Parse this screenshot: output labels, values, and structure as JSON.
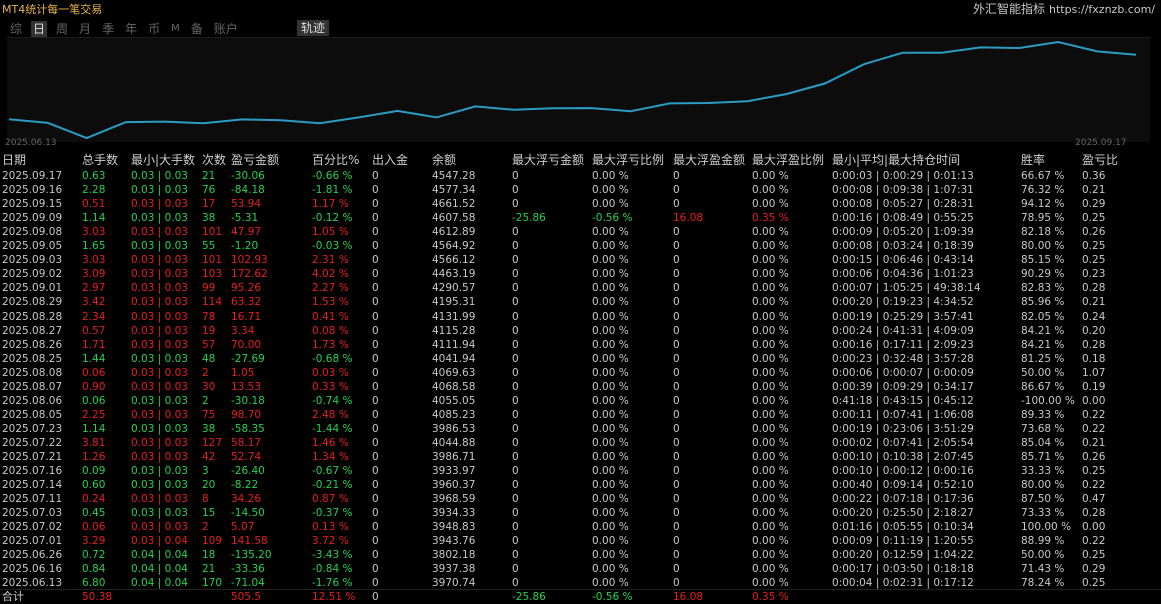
{
  "app": {
    "title": "MT4统计每一笔交易",
    "brand": "外汇智能指标",
    "brand_url": "https://fxznzb.com/"
  },
  "tabs": [
    {
      "label": "综",
      "active": false
    },
    {
      "label": "日",
      "active": true
    },
    {
      "label": "周",
      "active": false
    },
    {
      "label": "月",
      "active": false
    },
    {
      "label": "季",
      "active": false
    },
    {
      "label": "年",
      "active": false
    },
    {
      "label": "币",
      "active": false
    },
    {
      "label": "M",
      "active": false
    },
    {
      "label": "备",
      "active": false
    },
    {
      "label": "账户",
      "active": false
    }
  ],
  "track_button": "轨迹",
  "chart_data": {
    "type": "line",
    "x_start_label": "2025.06.13",
    "x_end_label": "2025.09.17",
    "color": "#2a9dc4",
    "values": [
      3970.74,
      3937.38,
      3802.18,
      3943.76,
      3948.83,
      3934.33,
      3968.59,
      3960.37,
      3933.97,
      3986.71,
      4044.88,
      3986.53,
      4085.23,
      4055.05,
      4068.58,
      4069.63,
      4041.94,
      4111.94,
      4115.28,
      4131.99,
      4195.31,
      4290.57,
      4463.19,
      4566.12,
      4564.92,
      4612.89,
      4607.58,
      4661.52,
      4577.34,
      4547.28
    ]
  },
  "colors": {
    "positive": "#26d04f",
    "negative": "#e61e1e",
    "neutral": "#c8c8c8"
  },
  "table": {
    "columns": [
      "日期",
      "总手数",
      "最小|大手数",
      "次数",
      "盈亏金额",
      "百分比%",
      "出入金",
      "余额",
      "最大浮亏金额",
      "最大浮亏比例",
      "最大浮盈金额",
      "最大浮盈比例",
      "最小|平均|最大持仓时间",
      "胜率",
      "盈亏比"
    ],
    "rows": [
      {
        "date": "2025.09.17",
        "lots": "0.63",
        "minmax": "0.03 | 0.03",
        "count": "21",
        "pl": "-30.06",
        "pct": "-0.66 %",
        "dep": "0",
        "bal": "4547.28",
        "mfl": "0",
        "mflp": "0.00 %",
        "mfp": "0",
        "mfpp": "0.00 %",
        "hold": "0:00:03 | 0:00:29 | 0:01:13",
        "win": "66.67 %",
        "rr": "0.36",
        "sign": "pos"
      },
      {
        "date": "2025.09.16",
        "lots": "2.28",
        "minmax": "0.03 | 0.03",
        "count": "76",
        "pl": "-84.18",
        "pct": "-1.81 %",
        "dep": "0",
        "bal": "4577.34",
        "mfl": "0",
        "mflp": "0.00 %",
        "mfp": "0",
        "mfpp": "0.00 %",
        "hold": "0:00:08 | 0:09:38 | 1:07:31",
        "win": "76.32 %",
        "rr": "0.21",
        "sign": "pos"
      },
      {
        "date": "2025.09.15",
        "lots": "0.51",
        "minmax": "0.03 | 0.03",
        "count": "17",
        "pl": "53.94",
        "pct": "1.17 %",
        "dep": "0",
        "bal": "4661.52",
        "mfl": "0",
        "mflp": "0.00 %",
        "mfp": "0",
        "mfpp": "0.00 %",
        "hold": "0:00:08 | 0:05:27 | 0:28:31",
        "win": "94.12 %",
        "rr": "0.29",
        "sign": "neg"
      },
      {
        "date": "2025.09.09",
        "lots": "1.14",
        "minmax": "0.03 | 0.03",
        "count": "38",
        "pl": "-5.31",
        "pct": "-0.12 %",
        "dep": "0",
        "bal": "4607.58",
        "mfl": "-25.86",
        "mflp": "-0.56 %",
        "mfp": "16.08",
        "mfpp": "0.35 %",
        "hold": "0:00:16 | 0:08:49 | 0:55:25",
        "win": "78.95 %",
        "rr": "0.25",
        "sign": "pos"
      },
      {
        "date": "2025.09.08",
        "lots": "3.03",
        "minmax": "0.03 | 0.03",
        "count": "101",
        "pl": "47.97",
        "pct": "1.05 %",
        "dep": "0",
        "bal": "4612.89",
        "mfl": "0",
        "mflp": "0.00 %",
        "mfp": "0",
        "mfpp": "0.00 %",
        "hold": "0:00:09 | 0:05:20 | 1:09:39",
        "win": "82.18 %",
        "rr": "0.26",
        "sign": "neg"
      },
      {
        "date": "2025.09.05",
        "lots": "1.65",
        "minmax": "0.03 | 0.03",
        "count": "55",
        "pl": "-1.20",
        "pct": "-0.03 %",
        "dep": "0",
        "bal": "4564.92",
        "mfl": "0",
        "mflp": "0.00 %",
        "mfp": "0",
        "mfpp": "0.00 %",
        "hold": "0:00:08 | 0:03:24 | 0:18:39",
        "win": "80.00 %",
        "rr": "0.25",
        "sign": "pos"
      },
      {
        "date": "2025.09.03",
        "lots": "3.03",
        "minmax": "0.03 | 0.03",
        "count": "101",
        "pl": "102.93",
        "pct": "2.31 %",
        "dep": "0",
        "bal": "4566.12",
        "mfl": "0",
        "mflp": "0.00 %",
        "mfp": "0",
        "mfpp": "0.00 %",
        "hold": "0:00:15 | 0:06:46 | 0:43:14",
        "win": "85.15 %",
        "rr": "0.25",
        "sign": "neg"
      },
      {
        "date": "2025.09.02",
        "lots": "3.09",
        "minmax": "0.03 | 0.03",
        "count": "103",
        "pl": "172.62",
        "pct": "4.02 %",
        "dep": "0",
        "bal": "4463.19",
        "mfl": "0",
        "mflp": "0.00 %",
        "mfp": "0",
        "mfpp": "0.00 %",
        "hold": "0:00:06 | 0:04:36 | 1:01:23",
        "win": "90.29 %",
        "rr": "0.23",
        "sign": "neg"
      },
      {
        "date": "2025.09.01",
        "lots": "2.97",
        "minmax": "0.03 | 0.03",
        "count": "99",
        "pl": "95.26",
        "pct": "2.27 %",
        "dep": "0",
        "bal": "4290.57",
        "mfl": "0",
        "mflp": "0.00 %",
        "mfp": "0",
        "mfpp": "0.00 %",
        "hold": "0:00:07 | 1:05:25 | 49:38:14",
        "win": "82.83 %",
        "rr": "0.28",
        "sign": "neg"
      },
      {
        "date": "2025.08.29",
        "lots": "3.42",
        "minmax": "0.03 | 0.03",
        "count": "114",
        "pl": "63.32",
        "pct": "1.53 %",
        "dep": "0",
        "bal": "4195.31",
        "mfl": "0",
        "mflp": "0.00 %",
        "mfp": "0",
        "mfpp": "0.00 %",
        "hold": "0:00:20 | 0:19:23 | 4:34:52",
        "win": "85.96 %",
        "rr": "0.21",
        "sign": "neg"
      },
      {
        "date": "2025.08.28",
        "lots": "2.34",
        "minmax": "0.03 | 0.03",
        "count": "78",
        "pl": "16.71",
        "pct": "0.41 %",
        "dep": "0",
        "bal": "4131.99",
        "mfl": "0",
        "mflp": "0.00 %",
        "mfp": "0",
        "mfpp": "0.00 %",
        "hold": "0:00:19 | 0:25:29 | 3:57:41",
        "win": "82.05 %",
        "rr": "0.24",
        "sign": "neg"
      },
      {
        "date": "2025.08.27",
        "lots": "0.57",
        "minmax": "0.03 | 0.03",
        "count": "19",
        "pl": "3.34",
        "pct": "0.08 %",
        "dep": "0",
        "bal": "4115.28",
        "mfl": "0",
        "mflp": "0.00 %",
        "mfp": "0",
        "mfpp": "0.00 %",
        "hold": "0:00:24 | 0:41:31 | 4:09:09",
        "win": "84.21 %",
        "rr": "0.20",
        "sign": "neg"
      },
      {
        "date": "2025.08.26",
        "lots": "1.71",
        "minmax": "0.03 | 0.03",
        "count": "57",
        "pl": "70.00",
        "pct": "1.73 %",
        "dep": "0",
        "bal": "4111.94",
        "mfl": "0",
        "mflp": "0.00 %",
        "mfp": "0",
        "mfpp": "0.00 %",
        "hold": "0:00:16 | 0:17:11 | 2:09:23",
        "win": "84.21 %",
        "rr": "0.28",
        "sign": "neg"
      },
      {
        "date": "2025.08.25",
        "lots": "1.44",
        "minmax": "0.03 | 0.03",
        "count": "48",
        "pl": "-27.69",
        "pct": "-0.68 %",
        "dep": "0",
        "bal": "4041.94",
        "mfl": "0",
        "mflp": "0.00 %",
        "mfp": "0",
        "mfpp": "0.00 %",
        "hold": "0:00:23 | 0:32:48 | 3:57:28",
        "win": "81.25 %",
        "rr": "0.18",
        "sign": "pos"
      },
      {
        "date": "2025.08.08",
        "lots": "0.06",
        "minmax": "0.03 | 0.03",
        "count": "2",
        "pl": "1.05",
        "pct": "0.03 %",
        "dep": "0",
        "bal": "4069.63",
        "mfl": "0",
        "mflp": "0.00 %",
        "mfp": "0",
        "mfpp": "0.00 %",
        "hold": "0:00:06 | 0:00:07 | 0:00:09",
        "win": "50.00 %",
        "rr": "1.07",
        "sign": "neg"
      },
      {
        "date": "2025.08.07",
        "lots": "0.90",
        "minmax": "0.03 | 0.03",
        "count": "30",
        "pl": "13.53",
        "pct": "0.33 %",
        "dep": "0",
        "bal": "4068.58",
        "mfl": "0",
        "mflp": "0.00 %",
        "mfp": "0",
        "mfpp": "0.00 %",
        "hold": "0:00:39 | 0:09:29 | 0:34:17",
        "win": "86.67 %",
        "rr": "0.19",
        "sign": "neg"
      },
      {
        "date": "2025.08.06",
        "lots": "0.06",
        "minmax": "0.03 | 0.03",
        "count": "2",
        "pl": "-30.18",
        "pct": "-0.74 %",
        "dep": "0",
        "bal": "4055.05",
        "mfl": "0",
        "mflp": "0.00 %",
        "mfp": "0",
        "mfpp": "0.00 %",
        "hold": "0:41:18 | 0:43:15 | 0:45:12",
        "win": "-100.00 %",
        "rr": "0.00",
        "sign": "pos"
      },
      {
        "date": "2025.08.05",
        "lots": "2.25",
        "minmax": "0.03 | 0.03",
        "count": "75",
        "pl": "98.70",
        "pct": "2.48 %",
        "dep": "0",
        "bal": "4085.23",
        "mfl": "0",
        "mflp": "0.00 %",
        "mfp": "0",
        "mfpp": "0.00 %",
        "hold": "0:00:11 | 0:07:41 | 1:06:08",
        "win": "89.33 %",
        "rr": "0.22",
        "sign": "neg"
      },
      {
        "date": "2025.07.23",
        "lots": "1.14",
        "minmax": "0.03 | 0.03",
        "count": "38",
        "pl": "-58.35",
        "pct": "-1.44 %",
        "dep": "0",
        "bal": "3986.53",
        "mfl": "0",
        "mflp": "0.00 %",
        "mfp": "0",
        "mfpp": "0.00 %",
        "hold": "0:00:19 | 0:23:06 | 3:51:29",
        "win": "73.68 %",
        "rr": "0.22",
        "sign": "pos"
      },
      {
        "date": "2025.07.22",
        "lots": "3.81",
        "minmax": "0.03 | 0.03",
        "count": "127",
        "pl": "58.17",
        "pct": "1.46 %",
        "dep": "0",
        "bal": "4044.88",
        "mfl": "0",
        "mflp": "0.00 %",
        "mfp": "0",
        "mfpp": "0.00 %",
        "hold": "0:00:02 | 0:07:41 | 2:05:54",
        "win": "85.04 %",
        "rr": "0.21",
        "sign": "neg"
      },
      {
        "date": "2025.07.21",
        "lots": "1.26",
        "minmax": "0.03 | 0.03",
        "count": "42",
        "pl": "52.74",
        "pct": "1.34 %",
        "dep": "0",
        "bal": "3986.71",
        "mfl": "0",
        "mflp": "0.00 %",
        "mfp": "0",
        "mfpp": "0.00 %",
        "hold": "0:00:10 | 0:10:38 | 2:07:45",
        "win": "85.71 %",
        "rr": "0.26",
        "sign": "neg"
      },
      {
        "date": "2025.07.16",
        "lots": "0.09",
        "minmax": "0.03 | 0.03",
        "count": "3",
        "pl": "-26.40",
        "pct": "-0.67 %",
        "dep": "0",
        "bal": "3933.97",
        "mfl": "0",
        "mflp": "0.00 %",
        "mfp": "0",
        "mfpp": "0.00 %",
        "hold": "0:00:10 | 0:00:12 | 0:00:16",
        "win": "33.33 %",
        "rr": "0.25",
        "sign": "pos"
      },
      {
        "date": "2025.07.14",
        "lots": "0.60",
        "minmax": "0.03 | 0.03",
        "count": "20",
        "pl": "-8.22",
        "pct": "-0.21 %",
        "dep": "0",
        "bal": "3960.37",
        "mfl": "0",
        "mflp": "0.00 %",
        "mfp": "0",
        "mfpp": "0.00 %",
        "hold": "0:00:40 | 0:09:14 | 0:52:10",
        "win": "80.00 %",
        "rr": "0.22",
        "sign": "pos"
      },
      {
        "date": "2025.07.11",
        "lots": "0.24",
        "minmax": "0.03 | 0.03",
        "count": "8",
        "pl": "34.26",
        "pct": "0.87 %",
        "dep": "0",
        "bal": "3968.59",
        "mfl": "0",
        "mflp": "0.00 %",
        "mfp": "0",
        "mfpp": "0.00 %",
        "hold": "0:00:22 | 0:07:18 | 0:17:36",
        "win": "87.50 %",
        "rr": "0.47",
        "sign": "neg"
      },
      {
        "date": "2025.07.03",
        "lots": "0.45",
        "minmax": "0.03 | 0.03",
        "count": "15",
        "pl": "-14.50",
        "pct": "-0.37 %",
        "dep": "0",
        "bal": "3934.33",
        "mfl": "0",
        "mflp": "0.00 %",
        "mfp": "0",
        "mfpp": "0.00 %",
        "hold": "0:00:20 | 0:25:50 | 2:18:27",
        "win": "73.33 %",
        "rr": "0.28",
        "sign": "pos"
      },
      {
        "date": "2025.07.02",
        "lots": "0.06",
        "minmax": "0.03 | 0.03",
        "count": "2",
        "pl": "5.07",
        "pct": "0.13 %",
        "dep": "0",
        "bal": "3948.83",
        "mfl": "0",
        "mflp": "0.00 %",
        "mfp": "0",
        "mfpp": "0.00 %",
        "hold": "0:01:16 | 0:05:55 | 0:10:34",
        "win": "100.00 %",
        "rr": "0.00",
        "sign": "neg"
      },
      {
        "date": "2025.07.01",
        "lots": "3.29",
        "minmax": "0.03 | 0.04",
        "count": "109",
        "pl": "141.58",
        "pct": "3.72 %",
        "dep": "0",
        "bal": "3943.76",
        "mfl": "0",
        "mflp": "0.00 %",
        "mfp": "0",
        "mfpp": "0.00 %",
        "hold": "0:00:09 | 0:11:19 | 1:20:55",
        "win": "88.99 %",
        "rr": "0.22",
        "sign": "neg"
      },
      {
        "date": "2025.06.26",
        "lots": "0.72",
        "minmax": "0.04 | 0.04",
        "count": "18",
        "pl": "-135.20",
        "pct": "-3.43 %",
        "dep": "0",
        "bal": "3802.18",
        "mfl": "0",
        "mflp": "0.00 %",
        "mfp": "0",
        "mfpp": "0.00 %",
        "hold": "0:00:20 | 0:12:59 | 1:04:22",
        "win": "50.00 %",
        "rr": "0.25",
        "sign": "pos"
      },
      {
        "date": "2025.06.16",
        "lots": "0.84",
        "minmax": "0.04 | 0.04",
        "count": "21",
        "pl": "-33.36",
        "pct": "-0.84 %",
        "dep": "0",
        "bal": "3937.38",
        "mfl": "0",
        "mflp": "0.00 %",
        "mfp": "0",
        "mfpp": "0.00 %",
        "hold": "0:00:17 | 0:03:50 | 0:18:18",
        "win": "71.43 %",
        "rr": "0.29",
        "sign": "pos"
      },
      {
        "date": "2025.06.13",
        "lots": "6.80",
        "minmax": "0.04 | 0.04",
        "count": "170",
        "pl": "-71.04",
        "pct": "-1.76 %",
        "dep": "0",
        "bal": "3970.74",
        "mfl": "0",
        "mflp": "0.00 %",
        "mfp": "0",
        "mfpp": "0.00 %",
        "hold": "0:00:04 | 0:02:31 | 0:17:12",
        "win": "78.24 %",
        "rr": "0.25",
        "sign": "pos"
      }
    ],
    "totals": {
      "label": "合计",
      "lots": "50.38",
      "pl": "505.5",
      "pct": "12.51 %",
      "dep": "0",
      "mfl": "-25.86",
      "mflp": "-0.56 %",
      "mfp": "16.08",
      "mfpp": "0.35 %"
    }
  }
}
